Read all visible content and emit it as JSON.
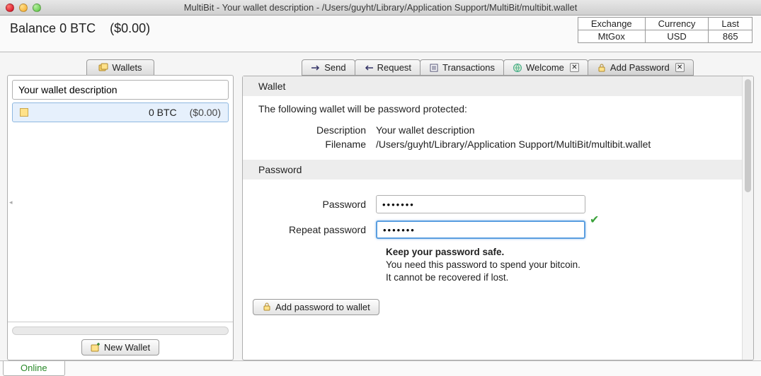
{
  "window": {
    "title": "MultiBit - Your wallet description - /Users/guyht/Library/Application Support/MultiBit/multibit.wallet"
  },
  "balance": {
    "label": "Balance",
    "amount": "0 BTC",
    "fiat": "($0.00)"
  },
  "exchange": {
    "headers": {
      "exchange": "Exchange",
      "currency": "Currency",
      "last": "Last"
    },
    "row": {
      "exchange": "MtGox",
      "currency": "USD",
      "last": "865"
    }
  },
  "sidebar": {
    "tab_label": "Wallets",
    "wallet_desc": "Your wallet description",
    "wallet_btc": "0 BTC",
    "wallet_fiat": "($0.00)",
    "new_wallet": "New Wallet"
  },
  "tabs": {
    "send": "Send",
    "request": "Request",
    "transactions": "Transactions",
    "welcome": "Welcome",
    "add_password": "Add Password"
  },
  "content": {
    "wallet_hdr": "Wallet",
    "intro": "The following wallet will be password protected:",
    "desc_label": "Description",
    "desc_value": "Your wallet description",
    "file_label": "Filename",
    "file_value": "/Users/guyht/Library/Application Support/MultiBit/multibit.wallet",
    "password_hdr": "Password",
    "pw_label": "Password",
    "pw_value": "•••••••",
    "rpw_label": "Repeat password",
    "rpw_value": "•••••••",
    "safe_bold": "Keep your password safe.",
    "safe_l1": "You need this password to spend your bitcoin.",
    "safe_l2": "It cannot be recovered if lost.",
    "add_btn": "Add password to wallet"
  },
  "status": {
    "online": "Online"
  }
}
